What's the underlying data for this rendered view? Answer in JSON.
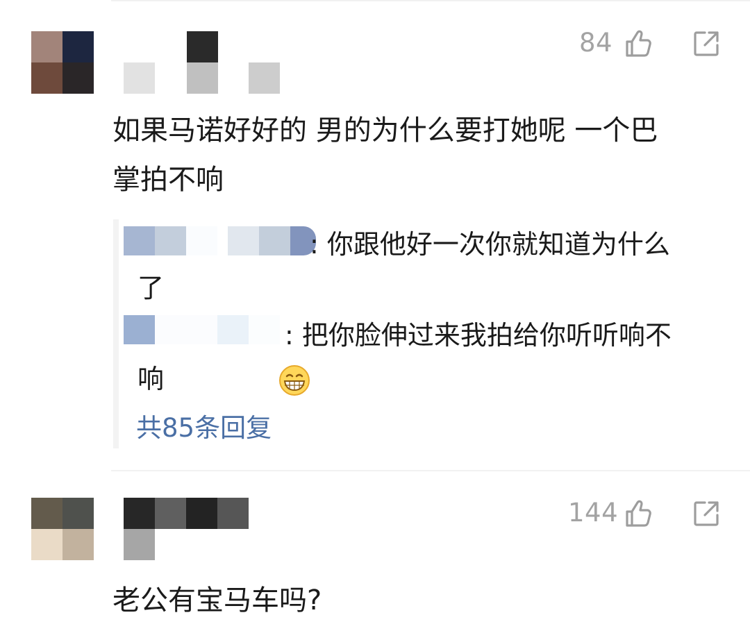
{
  "comments": [
    {
      "likes": "84",
      "text_line1": "如果马诺好好的 男的为什么要打她呢 一个巴",
      "text_line2": "掌拍不响",
      "replies": [
        {
          "text_line1": ": 你跟他好一次你就知道为什么",
          "text_line2": "了"
        },
        {
          "text_line1": ": 把你脸伸过来我拍给你听听响不",
          "text_line2": "响"
        }
      ],
      "more_replies": "共85条回复"
    },
    {
      "likes": "144",
      "text_line1": "老公有宝马车吗?"
    }
  ],
  "icons": {
    "like": "thumbs-up-icon",
    "share": "share-icon",
    "emoji": "grin-emoji-icon"
  },
  "colors": {
    "link": "#4a6fa5",
    "muted": "#a3a3a3"
  }
}
